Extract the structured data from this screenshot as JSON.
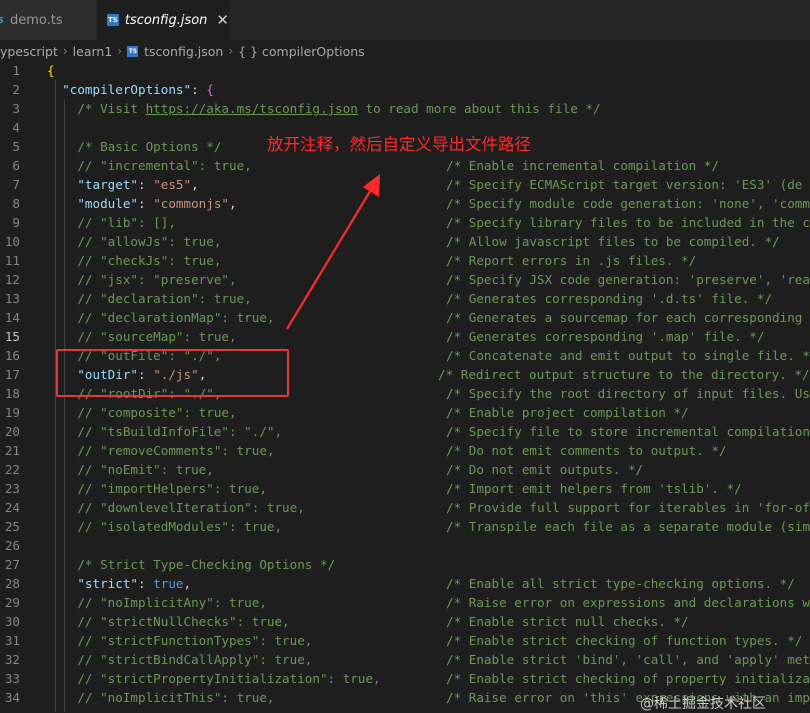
{
  "tabs": [
    {
      "name": "demo.ts",
      "icon": "typescript-file-icon"
    },
    {
      "name": "tsconfig.json",
      "icon": "typescript-config-icon"
    }
  ],
  "tab_first_icon_text": "S",
  "tab_second_icon_text": "TS",
  "breadcrumb": {
    "items": [
      "ypescript",
      "learn1",
      "tsconfig.json",
      "compilerOptions"
    ],
    "braces": "{ }"
  },
  "code_lines": [
    {
      "n": "1",
      "code": "<span class=\"br1\">{</span>",
      "cmt": ""
    },
    {
      "n": "2",
      "code": "  <span class=\"k\">\"compilerOptions\"</span><span class=\"p\">: </span><span class=\"br2\">{</span>",
      "cmt": ""
    },
    {
      "n": "3",
      "code": "    <span class=\"c\">/* Visit </span><span class=\"u\">https://aka.ms/tsconfig.json</span><span class=\"c\"> to read more about this file */</span>",
      "cmt": ""
    },
    {
      "n": "4",
      "code": "",
      "cmt": ""
    },
    {
      "n": "5",
      "code": "    <span class=\"c\">/* Basic Options */</span>",
      "cmt": ""
    },
    {
      "n": "6",
      "code": "    <span class=\"c\">// \"incremental\": true,</span>",
      "cmt": "/* Enable incremental compilation */"
    },
    {
      "n": "7",
      "code": "    <span class=\"k\">\"target\"</span><span class=\"p\">: </span><span class=\"s\">\"es5\"</span><span class=\"p\">,</span>",
      "cmt": "/* Specify ECMAScript target version: 'ES3' (de"
    },
    {
      "n": "8",
      "code": "    <span class=\"k\">\"module\"</span><span class=\"p\">: </span><span class=\"s\">\"commonjs\"</span><span class=\"p\">,</span>",
      "cmt": "/* Specify module code generation: 'none', 'comm"
    },
    {
      "n": "9",
      "code": "    <span class=\"c\">// \"lib\": [],</span>",
      "cmt": "/* Specify library files to be included in the c"
    },
    {
      "n": "10",
      "code": "    <span class=\"c\">// \"allowJs\": true,</span>",
      "cmt": "/* Allow javascript files to be compiled. */"
    },
    {
      "n": "11",
      "code": "    <span class=\"c\">// \"checkJs\": true,</span>",
      "cmt": "/* Report errors in .js files. */"
    },
    {
      "n": "12",
      "code": "    <span class=\"c\">// \"jsx\": \"preserve\",</span>",
      "cmt": "/* Specify JSX code generation: 'preserve', 'rea"
    },
    {
      "n": "13",
      "code": "    <span class=\"c\">// \"declaration\": true,</span>",
      "cmt": "/* Generates corresponding '.d.ts' file. */"
    },
    {
      "n": "14",
      "code": "    <span class=\"c\">// \"declarationMap\": true,</span>",
      "cmt": "/* Generates a sourcemap for each corresponding"
    },
    {
      "n": "15",
      "code": "    <span class=\"c\">// \"sourceMap\": true,</span>",
      "cmt": "/* Generates corresponding '.map' file. */"
    },
    {
      "n": "16",
      "code": "    <span class=\"c\">// \"outFile\": \"./\",</span>",
      "cmt": "/* Concatenate and emit output to single file. *"
    },
    {
      "n": "17",
      "code": "    <span class=\"k\">\"outDir\"</span><span class=\"p\">: </span><span class=\"s\">\"./js\"</span><span class=\"p\">,</span>",
      "cmt": "/* Redirect output structure to the directory. */"
    },
    {
      "n": "18",
      "code": "    <span class=\"c\">// \"rootDir\": \"./\",</span>",
      "cmt": "/* Specify the root directory of input files. Us"
    },
    {
      "n": "19",
      "code": "    <span class=\"c\">// \"composite\": true,</span>",
      "cmt": "/* Enable project compilation */"
    },
    {
      "n": "20",
      "code": "    <span class=\"c\">// \"tsBuildInfoFile\": \"./\",</span>",
      "cmt": "/* Specify file to store incremental compilation"
    },
    {
      "n": "21",
      "code": "    <span class=\"c\">// \"removeComments\": true,</span>",
      "cmt": "/* Do not emit comments to output. */"
    },
    {
      "n": "22",
      "code": "    <span class=\"c\">// \"noEmit\": true,</span>",
      "cmt": "/* Do not emit outputs. */"
    },
    {
      "n": "23",
      "code": "    <span class=\"c\">// \"importHelpers\": true,</span>",
      "cmt": "/* Import emit helpers from 'tslib'. */"
    },
    {
      "n": "24",
      "code": "    <span class=\"c\">// \"downlevelIteration\": true,</span>",
      "cmt": "/* Provide full support for iterables in 'for-of"
    },
    {
      "n": "25",
      "code": "    <span class=\"c\">// \"isolatedModules\": true,</span>",
      "cmt": "/* Transpile each file as a separate module (sim"
    },
    {
      "n": "26",
      "code": "",
      "cmt": ""
    },
    {
      "n": "27",
      "code": "    <span class=\"c\">/* Strict Type-Checking Options */</span>",
      "cmt": ""
    },
    {
      "n": "28",
      "code": "    <span class=\"k\">\"strict\"</span><span class=\"p\">: </span><span class=\"b\">true</span><span class=\"p\">,</span>",
      "cmt": "/* Enable all strict type-checking options. */"
    },
    {
      "n": "29",
      "code": "    <span class=\"c\">// \"noImplicitAny\": true,</span>",
      "cmt": "/* Raise error on expressions and declarations w"
    },
    {
      "n": "30",
      "code": "    <span class=\"c\">// \"strictNullChecks\": true,</span>",
      "cmt": "/* Enable strict null checks. */"
    },
    {
      "n": "31",
      "code": "    <span class=\"c\">// \"strictFunctionTypes\": true,</span>",
      "cmt": "/* Enable strict checking of function types. */"
    },
    {
      "n": "32",
      "code": "    <span class=\"c\">// \"strictBindCallApply\": true,</span>",
      "cmt": "/* Enable strict 'bind', 'call', and 'apply' met"
    },
    {
      "n": "33",
      "code": "    <span class=\"c\">// \"strictPropertyInitialization\": true,</span>",
      "cmt": "/* Enable strict checking of property initializa"
    },
    {
      "n": "34",
      "code": "    <span class=\"c\">// \"noImplicitThis\": true,</span>",
      "cmt": "/* Raise error on 'this' expressions with an imp"
    }
  ],
  "active_line": "15",
  "annotation": "放开注释，然后自定义导出文件路径",
  "watermark": "@稀土掘金技术社区",
  "colors": {
    "annotation": "#ff2a2a",
    "highlight_box": "#e53935",
    "key": "#9cdcfe",
    "string": "#ce9178",
    "comment": "#6a9955",
    "keyword": "#569cd6"
  }
}
